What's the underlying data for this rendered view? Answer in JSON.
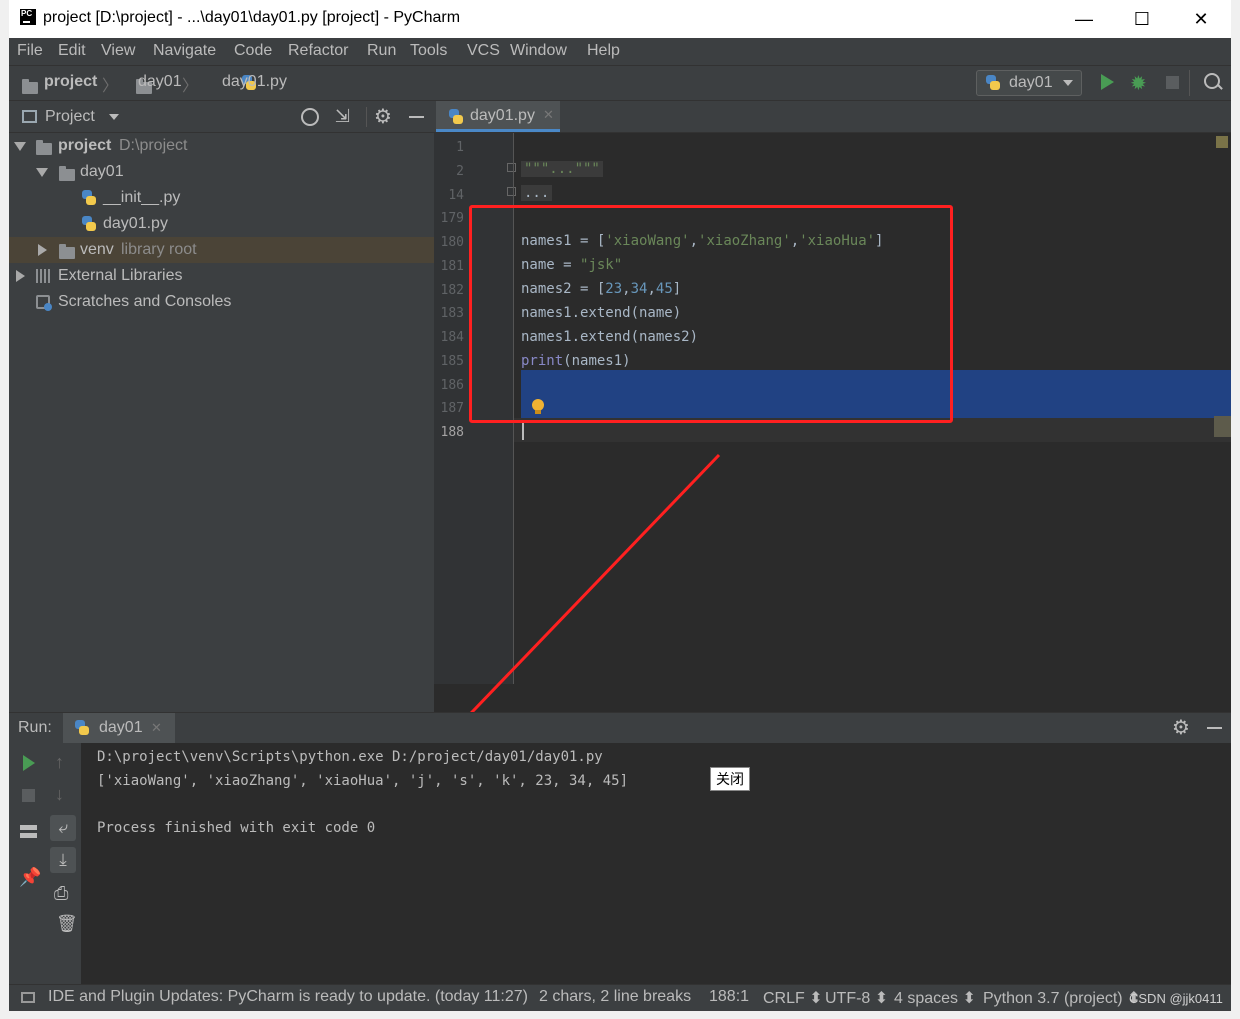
{
  "window": {
    "title": "project [D:\\project] - ...\\day01\\day01.py [project] - PyCharm",
    "minimize": "—",
    "maximize": "☐",
    "close": "✕"
  },
  "menu": [
    "File",
    "Edit",
    "View",
    "Navigate",
    "Code",
    "Refactor",
    "Run",
    "Tools",
    "VCS",
    "Window",
    "Help"
  ],
  "breadcrumb": {
    "root": "project",
    "folder": "day01",
    "file": "day01.py"
  },
  "run_config": {
    "label": "day01"
  },
  "project_panel": {
    "title": "Project",
    "tree": [
      {
        "name": "project",
        "hint": "D:\\project"
      },
      {
        "name": "day01",
        "hint": ""
      },
      {
        "name": "__init__.py",
        "hint": ""
      },
      {
        "name": "day01.py",
        "hint": ""
      },
      {
        "name": "venv",
        "hint": "library root"
      },
      {
        "name": "External Libraries",
        "hint": ""
      },
      {
        "name": "Scratches and Consoles",
        "hint": ""
      }
    ]
  },
  "editor": {
    "tab": "day01.py",
    "line_numbers": [
      "1",
      "2",
      "14",
      "179",
      "180",
      "181",
      "182",
      "183",
      "184",
      "185",
      "186",
      "187",
      "188"
    ],
    "folded_docstring": "\"\"\"...\"\"\"",
    "folded_ellipsis": "...",
    "code": {
      "l180_a": "names1 = [",
      "l180_s1": "'xiaoWang'",
      "l180_c1": ",",
      "l180_s2": "'xiaoZhang'",
      "l180_c2": ",",
      "l180_s3": "'xiaoHua'",
      "l180_b": "]",
      "l181_a": "name = ",
      "l181_s": "\"jsk\"",
      "l182_a": "names2 = [",
      "l182_n1": "23",
      "l182_c1": ",",
      "l182_n2": "34",
      "l182_c2": ",",
      "l182_n3": "45",
      "l182_b": "]",
      "l183": "names1.extend(name)",
      "l184": "names1.extend(names2)",
      "l185_fn": "print",
      "l185_rest": "(names1)"
    }
  },
  "run_panel": {
    "label": "Run:",
    "tab": "day01",
    "output": [
      "D:\\project\\venv\\Scripts\\python.exe D:/project/day01/day01.py",
      "['xiaoWang', 'xiaoZhang', 'xiaoHua', 'j', 's', 'k', 23, 34, 45]",
      "",
      "Process finished with exit code 0"
    ],
    "close_popup": "关闭"
  },
  "status_bar": {
    "message": "IDE and Plugin Updates: PyCharm is ready to update. (today 11:27)",
    "selection": "2 chars, 2 line breaks",
    "position": "188:1",
    "line_sep": "CRLF ⬍",
    "encoding": "UTF-8 ⬍",
    "indent": "4 spaces ⬍",
    "interpreter": "Python 3.7 (project) ⬍",
    "watermark": "CSDN @jjk0411"
  },
  "colors": {
    "annotation_red": "#ff2020",
    "selection_blue": "#214283",
    "run_green": "#499c54"
  }
}
